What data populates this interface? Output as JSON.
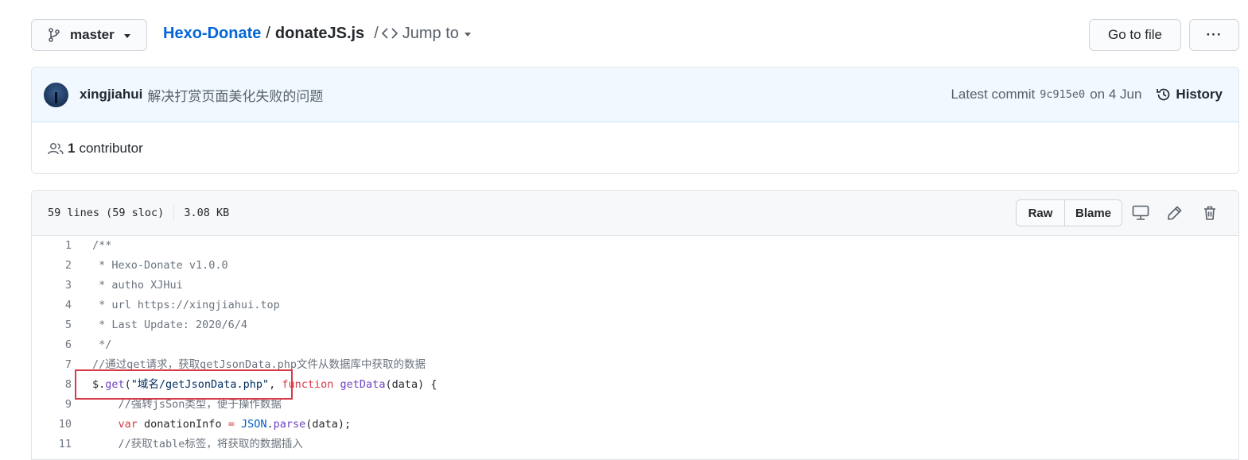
{
  "branch": {
    "icon": "git-branch-icon",
    "label": "master"
  },
  "breadcrumb": {
    "repo": "Hexo-Donate",
    "sep1": "/",
    "file": "donateJS.js",
    "sep2": "/",
    "jump_icon": "code-icon",
    "jump_label": "Jump to"
  },
  "header_actions": {
    "go_to_file": "Go to file",
    "more": "···"
  },
  "commit": {
    "author": "xingjiahui",
    "message": "解决打赏页面美化失败的问题",
    "latest_prefix": "Latest commit",
    "sha": "9c915e0",
    "date": "on 4 Jun",
    "history_label": "History"
  },
  "contributors": {
    "icon": "people-icon",
    "count": "1",
    "label": "contributor"
  },
  "file_header": {
    "lines": "59 lines (59 sloc)",
    "size": "3.08 KB",
    "raw": "Raw",
    "blame": "Blame",
    "icons": [
      "desktop-icon",
      "pencil-icon",
      "trash-icon"
    ]
  },
  "colors": {
    "link": "#0366d6",
    "highlight_box": "#d73a49",
    "commit_bg": "#f1f8ff"
  },
  "code": [
    {
      "n": "1",
      "t": [
        {
          "c": "c-cm",
          "v": "/**"
        }
      ]
    },
    {
      "n": "2",
      "t": [
        {
          "c": "c-cm",
          "v": " * Hexo-Donate v1.0.0"
        }
      ]
    },
    {
      "n": "3",
      "t": [
        {
          "c": "c-cm",
          "v": " * autho XJHui"
        }
      ]
    },
    {
      "n": "4",
      "t": [
        {
          "c": "c-cm",
          "v": " * url https://xingjiahui.top"
        }
      ]
    },
    {
      "n": "5",
      "t": [
        {
          "c": "c-cm",
          "v": " * Last Update: 2020/6/4"
        }
      ]
    },
    {
      "n": "6",
      "t": [
        {
          "c": "c-cm",
          "v": " */"
        }
      ]
    },
    {
      "n": "7",
      "t": [
        {
          "c": "c-cm",
          "v": "//通过get请求，获取getJsonData.php文件从数据库中获取的数据"
        }
      ]
    },
    {
      "n": "8",
      "t": [
        {
          "c": "c-tx",
          "v": "$."
        },
        {
          "c": "c-fn",
          "v": "get"
        },
        {
          "c": "c-tx",
          "v": "("
        },
        {
          "c": "c-st",
          "v": "\"域名/getJsonData.php\""
        },
        {
          "c": "c-tx",
          "v": ", "
        },
        {
          "c": "c-kw",
          "v": "function"
        },
        {
          "c": "c-tx",
          "v": " "
        },
        {
          "c": "c-fn",
          "v": "getData"
        },
        {
          "c": "c-tx",
          "v": "(data) {"
        }
      ]
    },
    {
      "n": "9",
      "t": [
        {
          "c": "c-cm",
          "v": "    //强转jsSon类型，便于操作数据"
        }
      ]
    },
    {
      "n": "10",
      "t": [
        {
          "c": "c-tx",
          "v": "    "
        },
        {
          "c": "c-kw",
          "v": "var"
        },
        {
          "c": "c-tx",
          "v": " donationInfo "
        },
        {
          "c": "c-kw",
          "v": "="
        },
        {
          "c": "c-tx",
          "v": " "
        },
        {
          "c": "c-cn",
          "v": "JSON"
        },
        {
          "c": "c-tx",
          "v": "."
        },
        {
          "c": "c-fn",
          "v": "parse"
        },
        {
          "c": "c-tx",
          "v": "(data);"
        }
      ]
    },
    {
      "n": "11",
      "t": [
        {
          "c": "c-cm",
          "v": "    //获取table标签，将获取的数据插入"
        }
      ]
    }
  ]
}
